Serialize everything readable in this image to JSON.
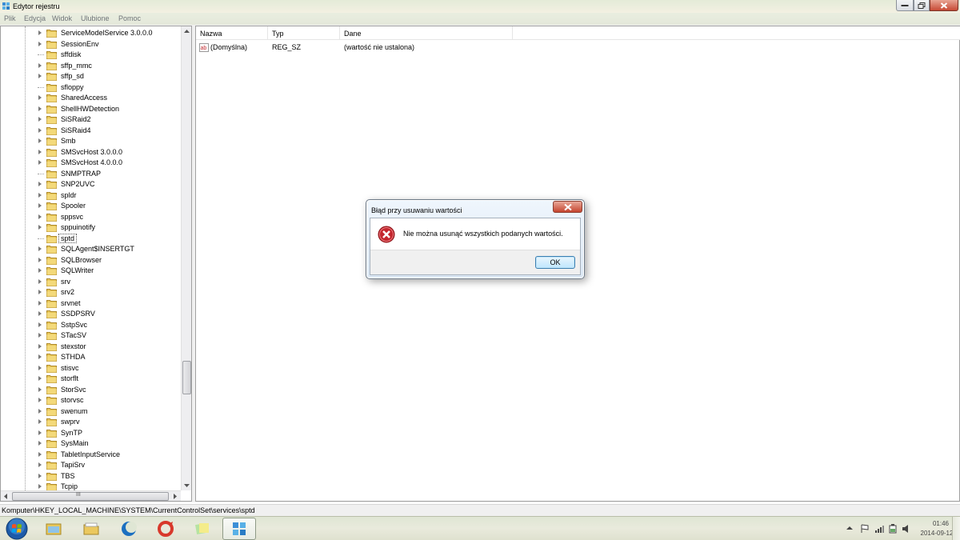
{
  "window": {
    "title": "Edytor rejestru"
  },
  "menu": [
    "Plik",
    "Edycja",
    "Widok",
    "Ulubione",
    "Pomoc"
  ],
  "tree": {
    "items": [
      {
        "label": "ServiceModelService 3.0.0.0",
        "expandable": true
      },
      {
        "label": "SessionEnv",
        "expandable": true
      },
      {
        "label": "sffdisk",
        "expandable": false
      },
      {
        "label": "sffp_mmc",
        "expandable": true
      },
      {
        "label": "sffp_sd",
        "expandable": true
      },
      {
        "label": "sfloppy",
        "expandable": false
      },
      {
        "label": "SharedAccess",
        "expandable": true
      },
      {
        "label": "ShellHWDetection",
        "expandable": true
      },
      {
        "label": "SiSRaid2",
        "expandable": true
      },
      {
        "label": "SiSRaid4",
        "expandable": true
      },
      {
        "label": "Smb",
        "expandable": true
      },
      {
        "label": "SMSvcHost 3.0.0.0",
        "expandable": true
      },
      {
        "label": "SMSvcHost 4.0.0.0",
        "expandable": true
      },
      {
        "label": "SNMPTRAP",
        "expandable": false
      },
      {
        "label": "SNP2UVC",
        "expandable": true
      },
      {
        "label": "spldr",
        "expandable": true
      },
      {
        "label": "Spooler",
        "expandable": true
      },
      {
        "label": "sppsvc",
        "expandable": true
      },
      {
        "label": "sppuinotify",
        "expandable": true
      },
      {
        "label": "sptd",
        "expandable": false,
        "selected": true
      },
      {
        "label": "SQLAgent$INSERTGT",
        "expandable": true
      },
      {
        "label": "SQLBrowser",
        "expandable": true
      },
      {
        "label": "SQLWriter",
        "expandable": true
      },
      {
        "label": "srv",
        "expandable": true
      },
      {
        "label": "srv2",
        "expandable": true
      },
      {
        "label": "srvnet",
        "expandable": true
      },
      {
        "label": "SSDPSRV",
        "expandable": true
      },
      {
        "label": "SstpSvc",
        "expandable": true
      },
      {
        "label": "STacSV",
        "expandable": true
      },
      {
        "label": "stexstor",
        "expandable": true
      },
      {
        "label": "STHDA",
        "expandable": true
      },
      {
        "label": "stisvc",
        "expandable": true
      },
      {
        "label": "storflt",
        "expandable": true
      },
      {
        "label": "StorSvc",
        "expandable": true
      },
      {
        "label": "storvsc",
        "expandable": true
      },
      {
        "label": "swenum",
        "expandable": true
      },
      {
        "label": "swprv",
        "expandable": true
      },
      {
        "label": "SynTP",
        "expandable": true
      },
      {
        "label": "SysMain",
        "expandable": true
      },
      {
        "label": "TabletInputService",
        "expandable": true
      },
      {
        "label": "TapiSrv",
        "expandable": true
      },
      {
        "label": "TBS",
        "expandable": true
      },
      {
        "label": "Tcpip",
        "expandable": true
      }
    ],
    "hscroll_grip": "III"
  },
  "list": {
    "columns": [
      "Nazwa",
      "Typ",
      "Dane"
    ],
    "rows": [
      {
        "name": "(Domyślna)",
        "type": "REG_SZ",
        "data": "(wartość nie ustalona)"
      }
    ]
  },
  "statusbar": {
    "path": "Komputer\\HKEY_LOCAL_MACHINE\\SYSTEM\\CurrentControlSet\\services\\sptd"
  },
  "dialog": {
    "title": "Błąd przy usuwaniu wartości",
    "message": "Nie można usunąć wszystkich podanych wartości.",
    "ok_label": "OK"
  },
  "taskbar": {
    "clock_time": "01:46",
    "clock_date": "2014-09-12"
  },
  "colors": {
    "folder": "#e8c85a",
    "error_red": "#c4262e",
    "selection_outline": "#555555"
  }
}
